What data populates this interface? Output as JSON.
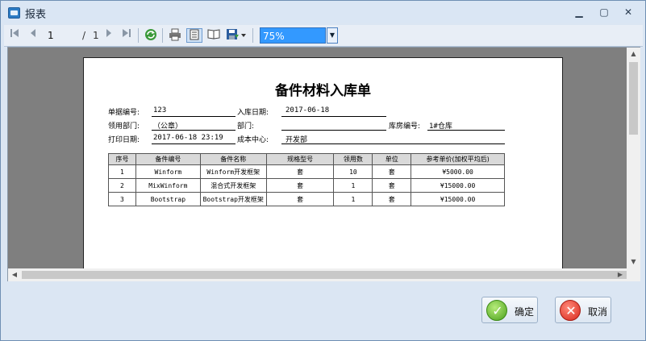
{
  "window": {
    "title": "报表",
    "controls": {
      "minimize": "▁",
      "maximize": "▢",
      "close": "✕"
    }
  },
  "toolbar": {
    "current_page": "1",
    "page_separator": "/",
    "total_pages": "1",
    "zoom": "75%",
    "icons": [
      "first-page-icon",
      "prev-page-icon",
      "next-page-icon",
      "last-page-icon",
      "refresh-icon",
      "print-icon",
      "page-layout-icon",
      "page-setup-icon",
      "export-icon"
    ]
  },
  "report": {
    "title": "备件材料入库单",
    "fields": {
      "doc_no_label": "单据编号:",
      "doc_no": "123",
      "date_label": "入库日期:",
      "date": "2017-06-18",
      "dept_label": "领用部门:",
      "dept": "（公章）",
      "section_label": "部门:",
      "section": "",
      "warehouse_label": "库房编号:",
      "warehouse": "1#仓库",
      "print_date_label": "打印日期:",
      "print_date": "2017-06-18 23:19",
      "cost_center_label": "成本中心:",
      "cost_center": "开发部"
    },
    "table": {
      "headers": [
        "序号",
        "备件编号",
        "备件名称",
        "规格型号",
        "领用数",
        "单位",
        "参考单价(加权平均后)"
      ],
      "rows": [
        [
          "1",
          "Winform",
          "Winform开发框架",
          "套",
          "10",
          "套",
          "¥5000.00"
        ],
        [
          "2",
          "MixWinform",
          "混合式开发框架",
          "套",
          "1",
          "套",
          "¥15000.00"
        ],
        [
          "3",
          "Bootstrap",
          "Bootstrap开发框架",
          "套",
          "1",
          "套",
          "¥15000.00"
        ]
      ]
    }
  },
  "buttons": {
    "ok_label": "确定",
    "cancel_label": "取消"
  },
  "colors": {
    "zoom_highlight": "#3399ff",
    "viewer_background": "#7f7f7f",
    "ok_green": "#4aa01c",
    "cancel_red": "#d8261b"
  }
}
